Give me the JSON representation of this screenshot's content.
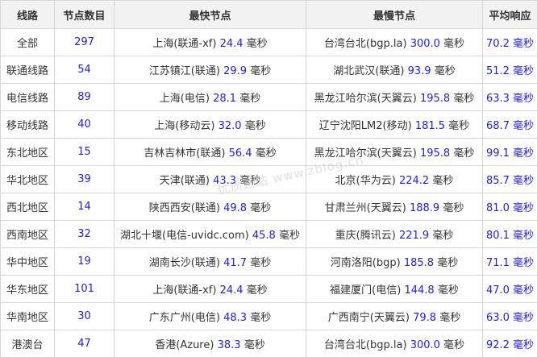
{
  "table": {
    "headers": [
      "线路",
      "节点数目",
      "最快节点",
      "最慢节点",
      "平均响应"
    ],
    "unit": "毫秒",
    "rows": [
      {
        "route": "全部",
        "count": "297",
        "fast_loc": "上海(联通-xf)",
        "fast_ms": "24.4",
        "slow_loc": "台湾台北(bgp.la)",
        "slow_ms": "300.0",
        "avg": "70.2 毫秒"
      },
      {
        "route": "联通线路",
        "count": "54",
        "fast_loc": "江苏镇江(联通)",
        "fast_ms": "29.9",
        "slow_loc": "湖北武汉(联通)",
        "slow_ms": "93.9",
        "avg": "51.2 毫秒"
      },
      {
        "route": "电信线路",
        "count": "89",
        "fast_loc": "上海(电信)",
        "fast_ms": "28.1",
        "slow_loc": "黑龙江哈尔滨(天翼云)",
        "slow_ms": "195.8",
        "avg": "63.3 毫秒"
      },
      {
        "route": "移动线路",
        "count": "40",
        "fast_loc": "上海(移动云)",
        "fast_ms": "32.0",
        "slow_loc": "辽宁沈阳LM2(移动)",
        "slow_ms": "181.5",
        "avg": "68.7 毫秒"
      },
      {
        "route": "东北地区",
        "count": "15",
        "fast_loc": "吉林吉林市(联通)",
        "fast_ms": "56.4",
        "slow_loc": "黑龙江哈尔滨(天翼云)",
        "slow_ms": "195.8",
        "avg": "99.1 毫秒"
      },
      {
        "route": "华北地区",
        "count": "39",
        "fast_loc": "天津(联通)",
        "fast_ms": "43.3",
        "slow_loc": "北京(华为云)",
        "slow_ms": "224.2",
        "avg": "85.7 毫秒"
      },
      {
        "route": "西北地区",
        "count": "14",
        "fast_loc": "陕西西安(联通)",
        "fast_ms": "49.8",
        "slow_loc": "甘肃兰州(天翼云)",
        "slow_ms": "188.9",
        "avg": "81.0 毫秒"
      },
      {
        "route": "西南地区",
        "count": "32",
        "fast_loc": "湖北十堰(电信-uvidc.com)",
        "fast_ms": "45.8",
        "slow_loc": "重庆(腾讯云)",
        "slow_ms": "221.9",
        "avg": "80.1 毫秒"
      },
      {
        "route": "华中地区",
        "count": "19",
        "fast_loc": "湖南长沙(联通)",
        "fast_ms": "41.7",
        "slow_loc": "河南洛阳(bgp)",
        "slow_ms": "185.8",
        "avg": "71.1 毫秒"
      },
      {
        "route": "华东地区",
        "count": "101",
        "fast_loc": "上海(联通-xf)",
        "fast_ms": "24.4",
        "slow_loc": "福建厦门(电信)",
        "slow_ms": "144.8",
        "avg": "47.0 毫秒"
      },
      {
        "route": "华南地区",
        "count": "30",
        "fast_loc": "广东广州(电信)",
        "fast_ms": "48.3",
        "slow_loc": "广西南宁(天翼云)",
        "slow_ms": "79.8",
        "avg": "63.0 毫秒"
      },
      {
        "route": "港澳台",
        "count": "47",
        "fast_loc": "香港(Azure)",
        "fast_ms": "38.3",
        "slow_loc": "台湾台北(bgp.la)",
        "slow_ms": "300.0",
        "avg": "92.2 毫秒"
      }
    ]
  },
  "watermark": "优质建站 www.zblog.cn",
  "colors": {
    "value_blue": "#1f1fdc",
    "header_bg": "#f2f2f2",
    "border": "#d7d7d7",
    "text": "#333333"
  }
}
